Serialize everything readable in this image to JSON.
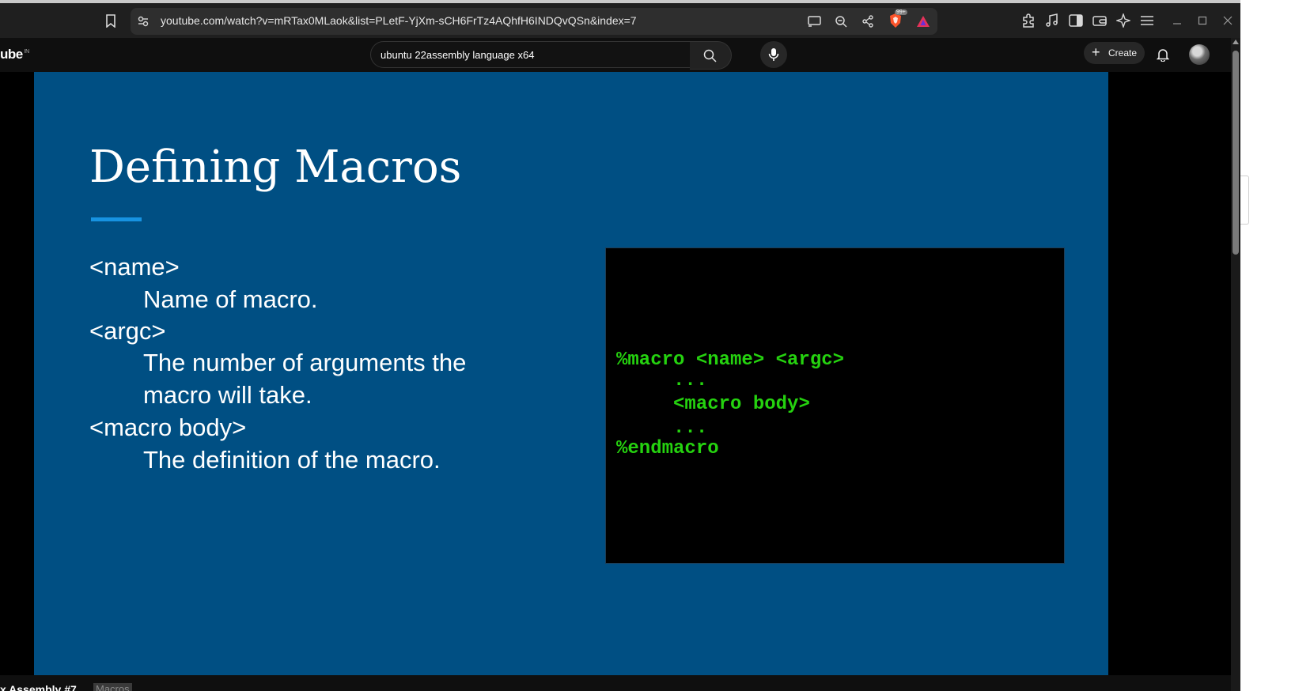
{
  "browser": {
    "url": "youtube.com/watch?v=mRTax0MLaok&list=PLetF-YjXm-sCH6FrTz4AQhfH6INDQvQSn&index=7",
    "shields_count": "99+"
  },
  "youtube": {
    "logo_text": "ube",
    "logo_region": "IN",
    "search_value": "ubuntu 22assembly language x64",
    "create_label": "Create"
  },
  "slide": {
    "title": "Defining Macros",
    "definitions": [
      {
        "term": "<name>",
        "desc": [
          "Name of macro."
        ]
      },
      {
        "term": "<argc>",
        "desc": [
          "The number of arguments the",
          "macro will take."
        ]
      },
      {
        "term": "<macro body>",
        "desc": [
          "The definition of the macro."
        ]
      }
    ],
    "code_lines": [
      "%macro <name> <argc>",
      "     ...",
      "     <macro body>",
      "     ...",
      "%endmacro"
    ],
    "accent_color": "#1793e1",
    "background_color": "#004f83",
    "code_color": "#25d20f"
  },
  "bottom": {
    "video_title": "x Assembly #7",
    "chip": "Macros"
  }
}
